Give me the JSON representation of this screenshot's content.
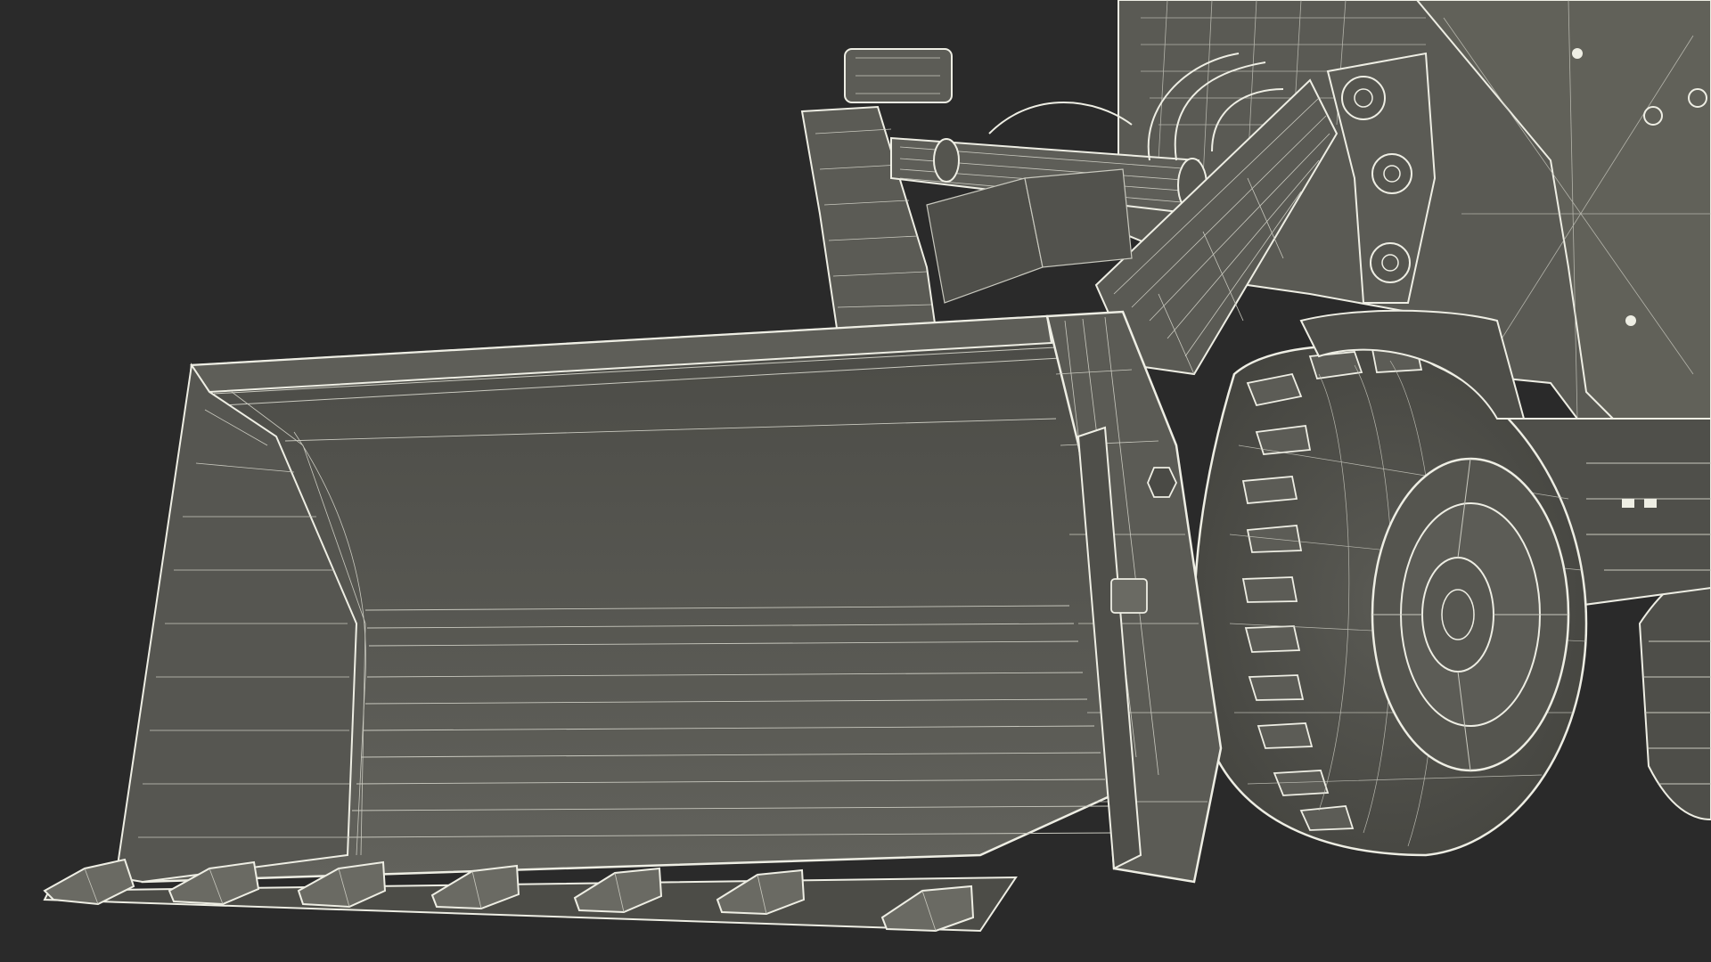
{
  "scene": {
    "subject": "wheel-loader-wireframe",
    "colors": {
      "background": "#2a2a2a",
      "body_fill": "#5d5d57",
      "body_fill_dark": "#4a4a45",
      "bucket_inner": "#54544f",
      "tire_fill": "#4e4e49",
      "wire": "#eeeee4",
      "wire_dim": "#c9c9bf"
    }
  }
}
